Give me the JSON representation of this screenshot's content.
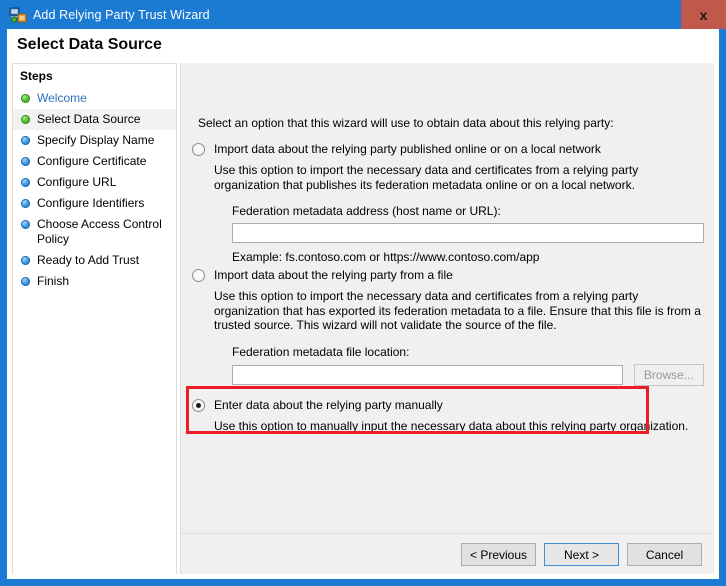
{
  "window": {
    "title": "Add Relying Party Trust Wizard",
    "icon": "relying-party-trust-icon",
    "close_label": "x",
    "titlebar_color": "#1b7ad1",
    "close_color": "#c0584b"
  },
  "header": {
    "title": "Select Data Source"
  },
  "sidebar": {
    "title": "Steps",
    "items": [
      {
        "label": "Welcome",
        "state": "done",
        "current": false,
        "link": true
      },
      {
        "label": "Select Data Source",
        "state": "done",
        "current": true,
        "link": false
      },
      {
        "label": "Specify Display Name",
        "state": "pending",
        "current": false,
        "link": false
      },
      {
        "label": "Configure Certificate",
        "state": "pending",
        "current": false,
        "link": false
      },
      {
        "label": "Configure URL",
        "state": "pending",
        "current": false,
        "link": false
      },
      {
        "label": "Configure Identifiers",
        "state": "pending",
        "current": false,
        "link": false
      },
      {
        "label": "Choose Access Control Policy",
        "state": "pending",
        "current": false,
        "link": false
      },
      {
        "label": "Ready to Add Trust",
        "state": "pending",
        "current": false,
        "link": false
      },
      {
        "label": "Finish",
        "state": "pending",
        "current": false,
        "link": false
      }
    ]
  },
  "main": {
    "intro": "Select an option that this wizard will use to obtain data about this relying party:",
    "options": [
      {
        "label": "Import data about the relying party published online or on a local network",
        "description": "Use this option to import the necessary data and certificates from a relying party organization that publishes its federation metadata online or on a local network.",
        "selected": false,
        "field_label": "Federation metadata address (host name or URL):",
        "field_value": "",
        "field_placeholder": "",
        "hint": "Example: fs.contoso.com or https://www.contoso.com/app"
      },
      {
        "label": "Import data about the relying party from a file",
        "description": "Use this option to import the necessary data and certificates from a relying party organization that has exported its federation metadata to a file. Ensure that this file is from a trusted source.  This wizard will not validate the source of the file.",
        "selected": false,
        "field_label": "Federation metadata file location:",
        "field_value": "",
        "field_placeholder": "",
        "browse_label": "Browse...",
        "browse_disabled": true
      },
      {
        "label": "Enter data about the relying party manually",
        "description": "Use this option to manually input the necessary data about this relying party organization.",
        "selected": true,
        "highlighted": true,
        "highlight_color": "#ec1c24"
      }
    ]
  },
  "footer": {
    "previous_label": "< Previous",
    "next_label": "Next >",
    "cancel_label": "Cancel"
  }
}
